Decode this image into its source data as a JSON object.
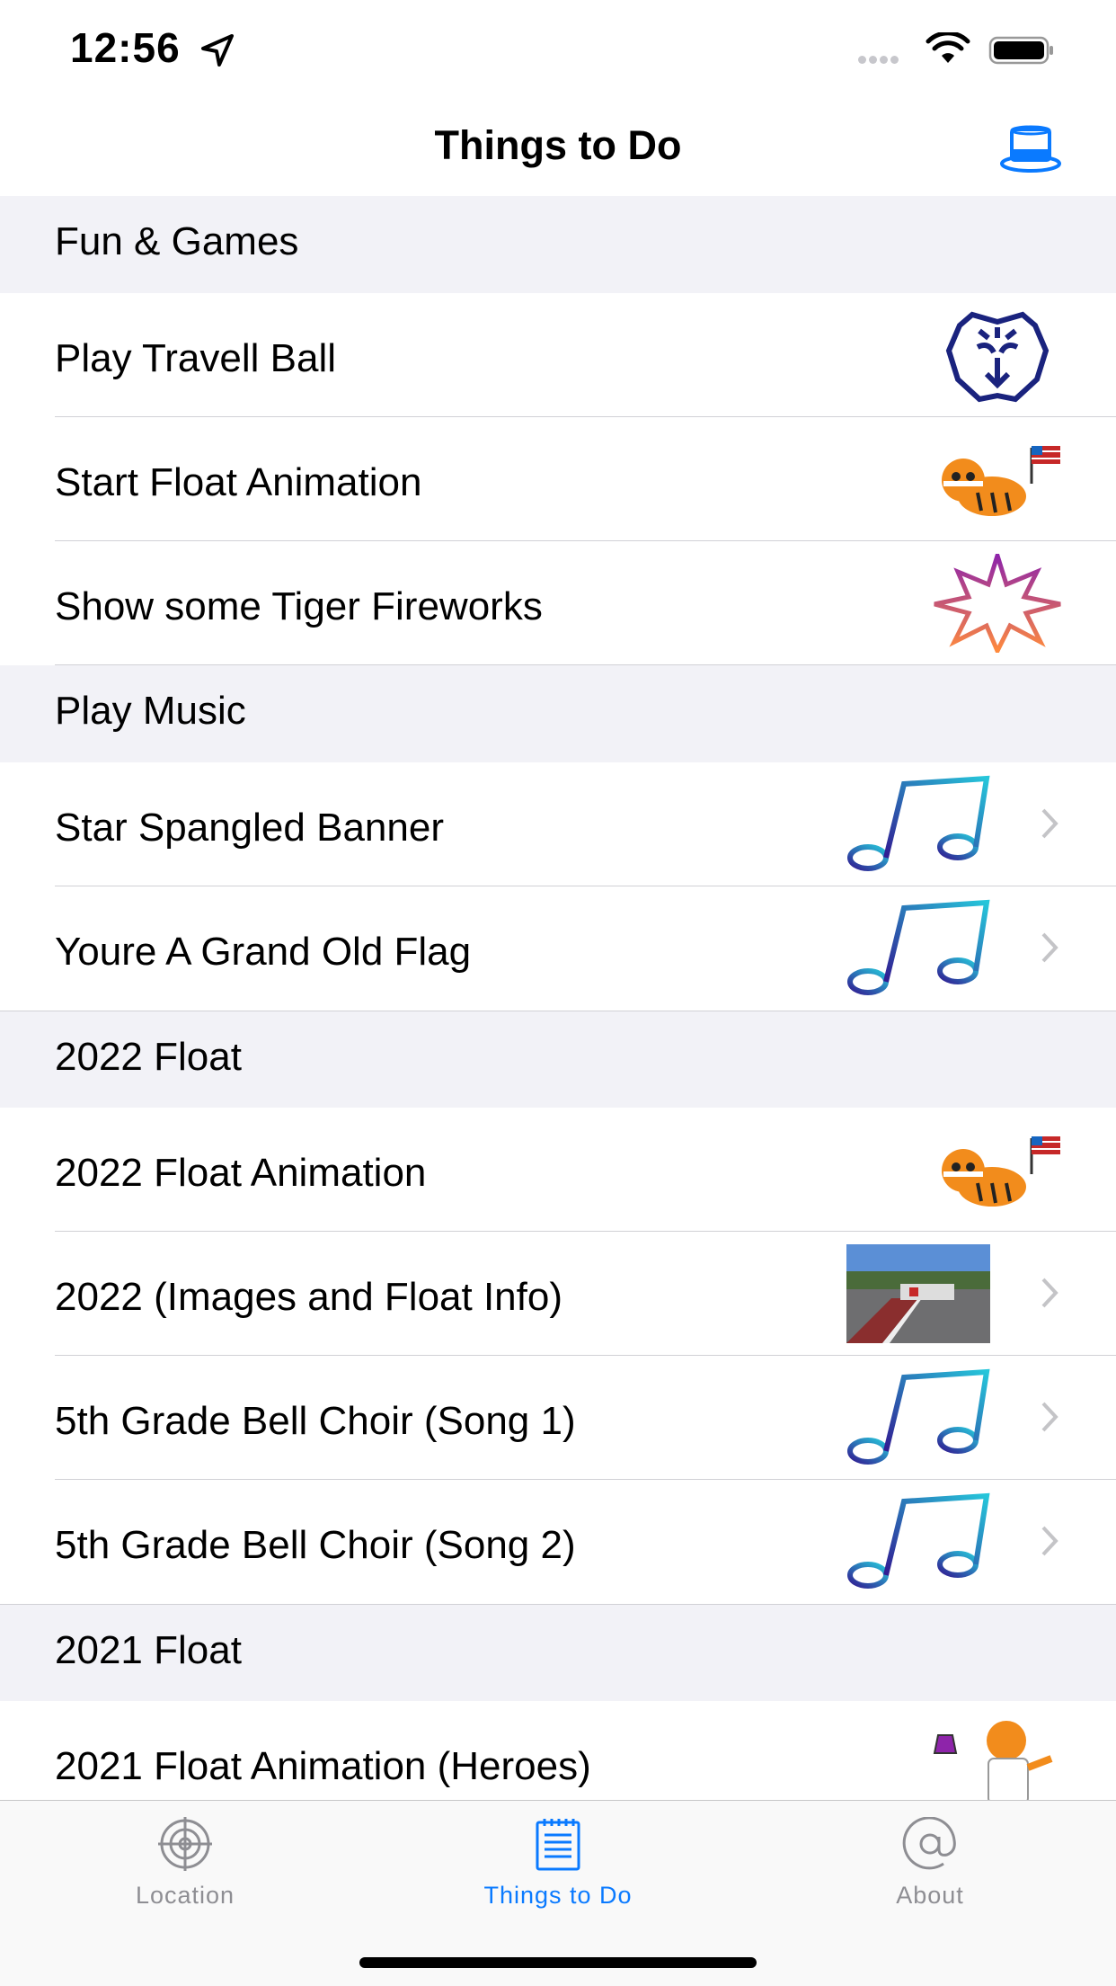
{
  "status_bar": {
    "time": "12:56"
  },
  "nav": {
    "title": "Things to Do"
  },
  "sections": {
    "fun": "Fun & Games",
    "music": "Play Music",
    "float2022": "2022 Float",
    "float2021": "2021 Float"
  },
  "rows": {
    "travell_ball": "Play Travell Ball",
    "float_anim": "Start Float Animation",
    "fireworks": "Show some Tiger Fireworks",
    "star_spangled": "Star Spangled Banner",
    "grand_old_flag": "Youre A Grand Old Flag",
    "float2022_anim": "2022 Float Animation",
    "float2022_images": "2022 (Images and Float Info)",
    "bell_choir_1": "5th Grade Bell Choir (Song 1)",
    "bell_choir_2": "5th Grade Bell Choir (Song 2)",
    "float2021_anim": "2021 Float Animation (Heroes)"
  },
  "tabs": {
    "location": "Location",
    "things": "Things to Do",
    "about": "About"
  },
  "colors": {
    "accent": "#0a7aff",
    "inactive_tab": "#8e8e93",
    "section_bg": "#f2f2f7"
  },
  "icons": [
    "location-arrow-icon",
    "wifi-icon",
    "battery-icon",
    "top-hat-icon",
    "tiger-head-icon",
    "tiger-flag-icon",
    "starburst-icon",
    "music-notes-icon",
    "chevron-right-icon",
    "target-icon",
    "notepad-icon",
    "at-sign-icon"
  ]
}
